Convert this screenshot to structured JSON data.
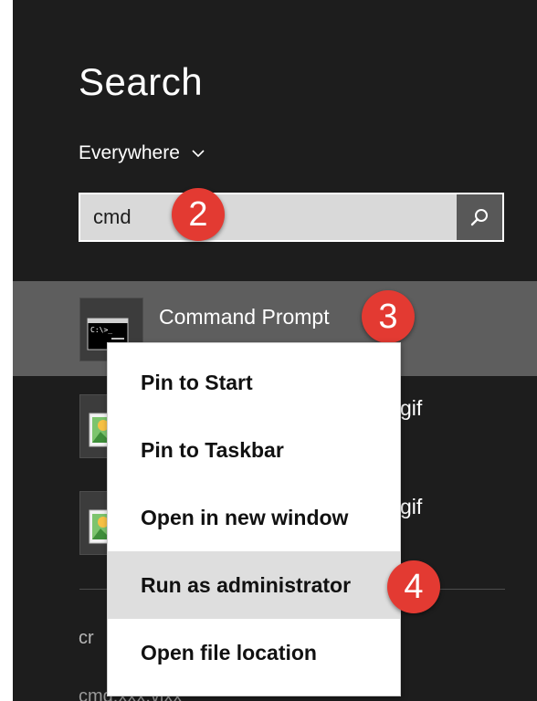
{
  "search_panel": {
    "title": "Search",
    "scope": "Everywhere",
    "query": "cmd"
  },
  "results": [
    {
      "label": "Command Prompt",
      "icon": "cmd-icon"
    },
    {
      "label": "gif",
      "icon": "image-file-icon"
    },
    {
      "label": "gif",
      "icon": "image-file-icon"
    }
  ],
  "partial_results": [
    "cr",
    "cmd.xxx.vixx"
  ],
  "context_menu": {
    "items": [
      "Pin to Start",
      "Pin to Taskbar",
      "Open in new window",
      "Run as administrator",
      "Open file location"
    ],
    "highlighted_index": 3
  },
  "annotations": {
    "step2": "2",
    "step3": "3",
    "step4": "4"
  },
  "colors": {
    "panel_bg": "#1d1d1d",
    "selected_bg": "#5e5e5e",
    "badge": "#e33a32",
    "search_box": "#d9d9d9",
    "menu_highlight": "#dedede"
  }
}
